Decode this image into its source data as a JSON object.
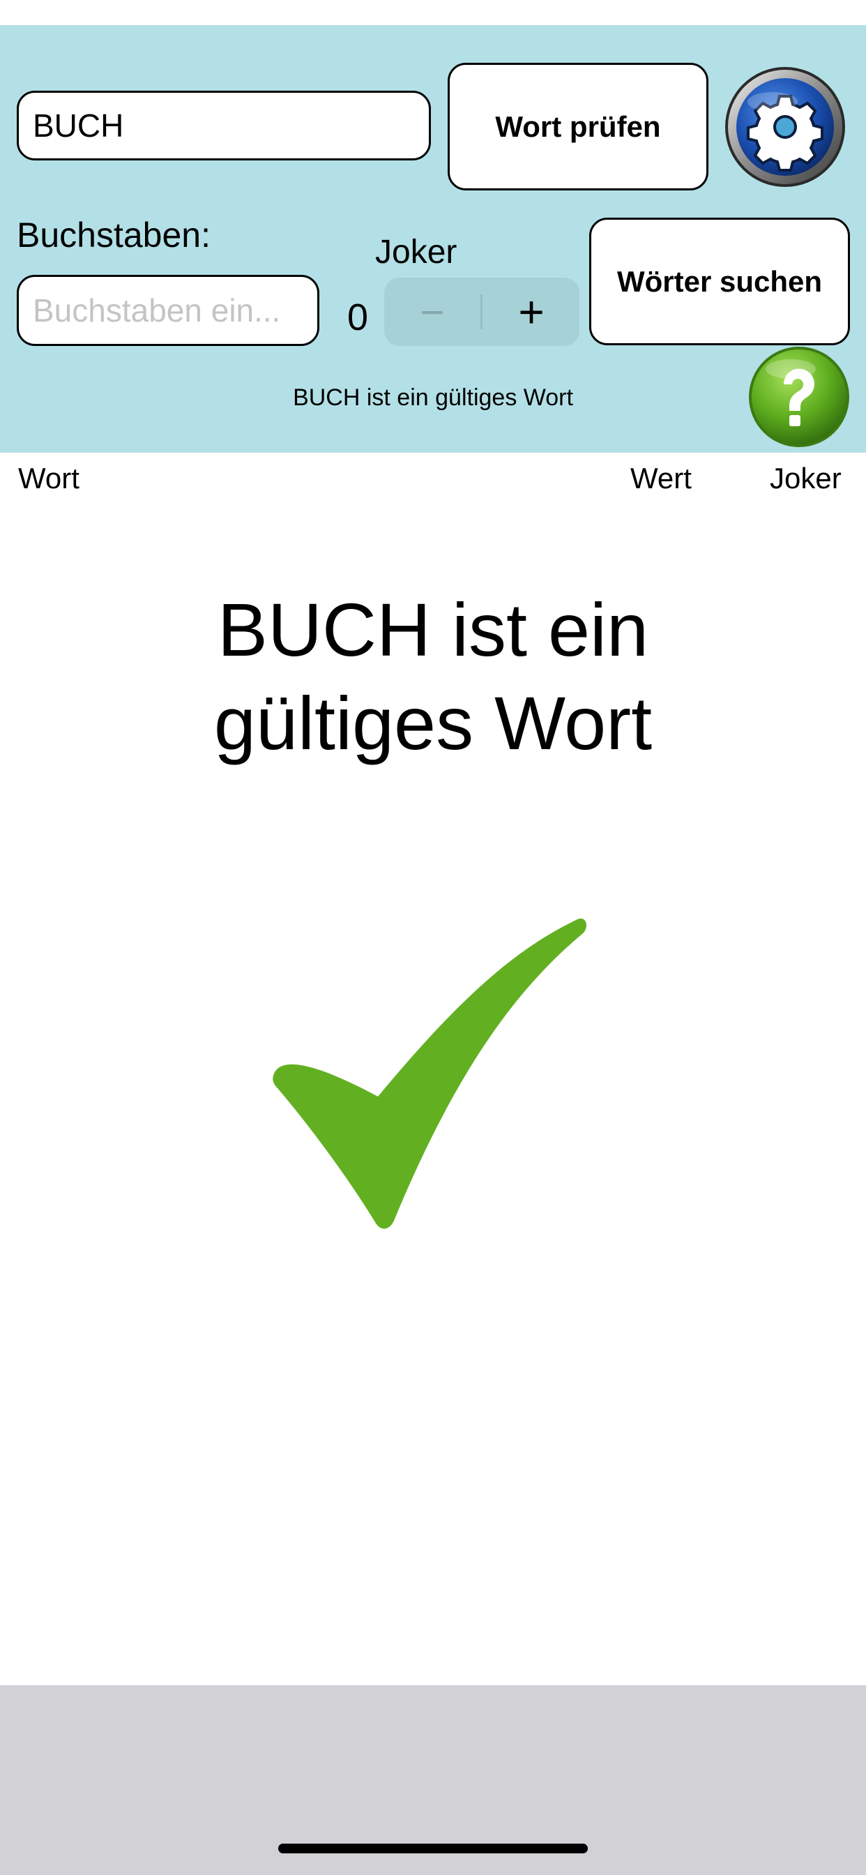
{
  "input": {
    "word_value": "BUCH",
    "letters_label": "Buchstaben:",
    "letters_placeholder": "Buchstaben ein..."
  },
  "buttons": {
    "check_word": "Wort prüfen",
    "search_words": "Wörter suchen",
    "settings_icon": "gear-icon",
    "help_icon": "question-mark-icon"
  },
  "joker": {
    "label": "Joker",
    "count": "0",
    "minus": "−",
    "plus": "+"
  },
  "status": {
    "message": "BUCH ist ein gültiges Wort"
  },
  "columns": {
    "word": "Wort",
    "value": "Wert",
    "joker": "Joker"
  },
  "result": {
    "line1": "BUCH ist ein",
    "line2": "gültiges Wort",
    "icon": "checkmark-icon"
  },
  "colors": {
    "panel_bg": "#b3e0e6",
    "check_green": "#62b021",
    "settings_blue": "#1a4fb0",
    "help_green": "#5fae1f",
    "bottom_bar": "#d1d1d6"
  }
}
